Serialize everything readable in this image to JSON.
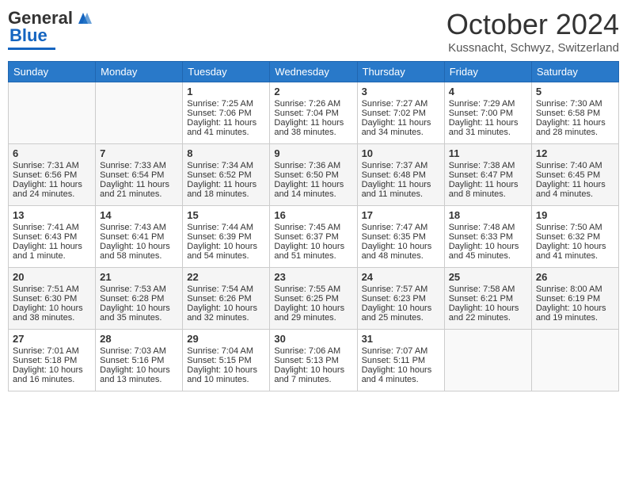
{
  "header": {
    "logo_general": "General",
    "logo_blue": "Blue",
    "month": "October 2024",
    "location": "Kussnacht, Schwyz, Switzerland"
  },
  "weekdays": [
    "Sunday",
    "Monday",
    "Tuesday",
    "Wednesday",
    "Thursday",
    "Friday",
    "Saturday"
  ],
  "weeks": [
    [
      {
        "day": "",
        "sunrise": "",
        "sunset": "",
        "daylight": ""
      },
      {
        "day": "",
        "sunrise": "",
        "sunset": "",
        "daylight": ""
      },
      {
        "day": "1",
        "sunrise": "Sunrise: 7:25 AM",
        "sunset": "Sunset: 7:06 PM",
        "daylight": "Daylight: 11 hours and 41 minutes."
      },
      {
        "day": "2",
        "sunrise": "Sunrise: 7:26 AM",
        "sunset": "Sunset: 7:04 PM",
        "daylight": "Daylight: 11 hours and 38 minutes."
      },
      {
        "day": "3",
        "sunrise": "Sunrise: 7:27 AM",
        "sunset": "Sunset: 7:02 PM",
        "daylight": "Daylight: 11 hours and 34 minutes."
      },
      {
        "day": "4",
        "sunrise": "Sunrise: 7:29 AM",
        "sunset": "Sunset: 7:00 PM",
        "daylight": "Daylight: 11 hours and 31 minutes."
      },
      {
        "day": "5",
        "sunrise": "Sunrise: 7:30 AM",
        "sunset": "Sunset: 6:58 PM",
        "daylight": "Daylight: 11 hours and 28 minutes."
      }
    ],
    [
      {
        "day": "6",
        "sunrise": "Sunrise: 7:31 AM",
        "sunset": "Sunset: 6:56 PM",
        "daylight": "Daylight: 11 hours and 24 minutes."
      },
      {
        "day": "7",
        "sunrise": "Sunrise: 7:33 AM",
        "sunset": "Sunset: 6:54 PM",
        "daylight": "Daylight: 11 hours and 21 minutes."
      },
      {
        "day": "8",
        "sunrise": "Sunrise: 7:34 AM",
        "sunset": "Sunset: 6:52 PM",
        "daylight": "Daylight: 11 hours and 18 minutes."
      },
      {
        "day": "9",
        "sunrise": "Sunrise: 7:36 AM",
        "sunset": "Sunset: 6:50 PM",
        "daylight": "Daylight: 11 hours and 14 minutes."
      },
      {
        "day": "10",
        "sunrise": "Sunrise: 7:37 AM",
        "sunset": "Sunset: 6:48 PM",
        "daylight": "Daylight: 11 hours and 11 minutes."
      },
      {
        "day": "11",
        "sunrise": "Sunrise: 7:38 AM",
        "sunset": "Sunset: 6:47 PM",
        "daylight": "Daylight: 11 hours and 8 minutes."
      },
      {
        "day": "12",
        "sunrise": "Sunrise: 7:40 AM",
        "sunset": "Sunset: 6:45 PM",
        "daylight": "Daylight: 11 hours and 4 minutes."
      }
    ],
    [
      {
        "day": "13",
        "sunrise": "Sunrise: 7:41 AM",
        "sunset": "Sunset: 6:43 PM",
        "daylight": "Daylight: 11 hours and 1 minute."
      },
      {
        "day": "14",
        "sunrise": "Sunrise: 7:43 AM",
        "sunset": "Sunset: 6:41 PM",
        "daylight": "Daylight: 10 hours and 58 minutes."
      },
      {
        "day": "15",
        "sunrise": "Sunrise: 7:44 AM",
        "sunset": "Sunset: 6:39 PM",
        "daylight": "Daylight: 10 hours and 54 minutes."
      },
      {
        "day": "16",
        "sunrise": "Sunrise: 7:45 AM",
        "sunset": "Sunset: 6:37 PM",
        "daylight": "Daylight: 10 hours and 51 minutes."
      },
      {
        "day": "17",
        "sunrise": "Sunrise: 7:47 AM",
        "sunset": "Sunset: 6:35 PM",
        "daylight": "Daylight: 10 hours and 48 minutes."
      },
      {
        "day": "18",
        "sunrise": "Sunrise: 7:48 AM",
        "sunset": "Sunset: 6:33 PM",
        "daylight": "Daylight: 10 hours and 45 minutes."
      },
      {
        "day": "19",
        "sunrise": "Sunrise: 7:50 AM",
        "sunset": "Sunset: 6:32 PM",
        "daylight": "Daylight: 10 hours and 41 minutes."
      }
    ],
    [
      {
        "day": "20",
        "sunrise": "Sunrise: 7:51 AM",
        "sunset": "Sunset: 6:30 PM",
        "daylight": "Daylight: 10 hours and 38 minutes."
      },
      {
        "day": "21",
        "sunrise": "Sunrise: 7:53 AM",
        "sunset": "Sunset: 6:28 PM",
        "daylight": "Daylight: 10 hours and 35 minutes."
      },
      {
        "day": "22",
        "sunrise": "Sunrise: 7:54 AM",
        "sunset": "Sunset: 6:26 PM",
        "daylight": "Daylight: 10 hours and 32 minutes."
      },
      {
        "day": "23",
        "sunrise": "Sunrise: 7:55 AM",
        "sunset": "Sunset: 6:25 PM",
        "daylight": "Daylight: 10 hours and 29 minutes."
      },
      {
        "day": "24",
        "sunrise": "Sunrise: 7:57 AM",
        "sunset": "Sunset: 6:23 PM",
        "daylight": "Daylight: 10 hours and 25 minutes."
      },
      {
        "day": "25",
        "sunrise": "Sunrise: 7:58 AM",
        "sunset": "Sunset: 6:21 PM",
        "daylight": "Daylight: 10 hours and 22 minutes."
      },
      {
        "day": "26",
        "sunrise": "Sunrise: 8:00 AM",
        "sunset": "Sunset: 6:19 PM",
        "daylight": "Daylight: 10 hours and 19 minutes."
      }
    ],
    [
      {
        "day": "27",
        "sunrise": "Sunrise: 7:01 AM",
        "sunset": "Sunset: 5:18 PM",
        "daylight": "Daylight: 10 hours and 16 minutes."
      },
      {
        "day": "28",
        "sunrise": "Sunrise: 7:03 AM",
        "sunset": "Sunset: 5:16 PM",
        "daylight": "Daylight: 10 hours and 13 minutes."
      },
      {
        "day": "29",
        "sunrise": "Sunrise: 7:04 AM",
        "sunset": "Sunset: 5:15 PM",
        "daylight": "Daylight: 10 hours and 10 minutes."
      },
      {
        "day": "30",
        "sunrise": "Sunrise: 7:06 AM",
        "sunset": "Sunset: 5:13 PM",
        "daylight": "Daylight: 10 hours and 7 minutes."
      },
      {
        "day": "31",
        "sunrise": "Sunrise: 7:07 AM",
        "sunset": "Sunset: 5:11 PM",
        "daylight": "Daylight: 10 hours and 4 minutes."
      },
      {
        "day": "",
        "sunrise": "",
        "sunset": "",
        "daylight": ""
      },
      {
        "day": "",
        "sunrise": "",
        "sunset": "",
        "daylight": ""
      }
    ]
  ]
}
